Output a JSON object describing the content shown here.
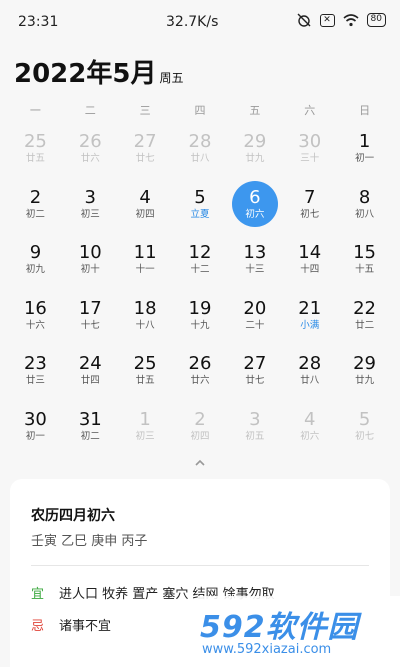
{
  "status_bar": {
    "time": "23:31",
    "net_speed": "32.7K/s",
    "battery": "80",
    "icons": [
      "alarm-off-icon",
      "sim-off-icon",
      "wifi-icon",
      "battery-icon"
    ]
  },
  "header": {
    "title": "2022年5月",
    "weekday": "周五"
  },
  "weekdays": [
    "一",
    "二",
    "三",
    "四",
    "五",
    "六",
    "日"
  ],
  "calendar": {
    "selected_day": 6,
    "accent_color": "#3d97ee",
    "days": [
      {
        "num": "25",
        "lunar": "廿五",
        "other": true
      },
      {
        "num": "26",
        "lunar": "廿六",
        "other": true
      },
      {
        "num": "27",
        "lunar": "廿七",
        "other": true
      },
      {
        "num": "28",
        "lunar": "廿八",
        "other": true
      },
      {
        "num": "29",
        "lunar": "廿九",
        "other": true
      },
      {
        "num": "30",
        "lunar": "三十",
        "other": true
      },
      {
        "num": "1",
        "lunar": "初一"
      },
      {
        "num": "2",
        "lunar": "初二"
      },
      {
        "num": "3",
        "lunar": "初三"
      },
      {
        "num": "4",
        "lunar": "初四"
      },
      {
        "num": "5",
        "lunar": "立夏",
        "term": true
      },
      {
        "num": "6",
        "lunar": "初六",
        "selected": true
      },
      {
        "num": "7",
        "lunar": "初七"
      },
      {
        "num": "8",
        "lunar": "初八"
      },
      {
        "num": "9",
        "lunar": "初九"
      },
      {
        "num": "10",
        "lunar": "初十"
      },
      {
        "num": "11",
        "lunar": "十一"
      },
      {
        "num": "12",
        "lunar": "十二"
      },
      {
        "num": "13",
        "lunar": "十三"
      },
      {
        "num": "14",
        "lunar": "十四"
      },
      {
        "num": "15",
        "lunar": "十五"
      },
      {
        "num": "16",
        "lunar": "十六"
      },
      {
        "num": "17",
        "lunar": "十七"
      },
      {
        "num": "18",
        "lunar": "十八"
      },
      {
        "num": "19",
        "lunar": "十九"
      },
      {
        "num": "20",
        "lunar": "二十"
      },
      {
        "num": "21",
        "lunar": "小满",
        "term": true
      },
      {
        "num": "22",
        "lunar": "廿二"
      },
      {
        "num": "23",
        "lunar": "廿三"
      },
      {
        "num": "24",
        "lunar": "廿四"
      },
      {
        "num": "25",
        "lunar": "廿五"
      },
      {
        "num": "26",
        "lunar": "廿六"
      },
      {
        "num": "27",
        "lunar": "廿七"
      },
      {
        "num": "28",
        "lunar": "廿八"
      },
      {
        "num": "29",
        "lunar": "廿九"
      },
      {
        "num": "30",
        "lunar": "初一"
      },
      {
        "num": "31",
        "lunar": "初二"
      },
      {
        "num": "1",
        "lunar": "初三",
        "other": true
      },
      {
        "num": "2",
        "lunar": "初四",
        "other": true
      },
      {
        "num": "3",
        "lunar": "初五",
        "other": true
      },
      {
        "num": "4",
        "lunar": "初六",
        "other": true
      },
      {
        "num": "5",
        "lunar": "初七",
        "other": true
      }
    ]
  },
  "detail": {
    "lunar_date": "农历四月初六",
    "ganzhi": "壬寅 乙巳 庚申 丙子",
    "yi_label": "宜",
    "yi_text": "进人口 牧养 置产 塞穴 结网 馀事勿取",
    "ji_label": "忌",
    "ji_text": "诸事不宜",
    "yi_color": "#3ba83e",
    "ji_color": "#e0443a"
  },
  "watermark": {
    "logo": "592软件园",
    "url": "www.592xiazai.com"
  }
}
